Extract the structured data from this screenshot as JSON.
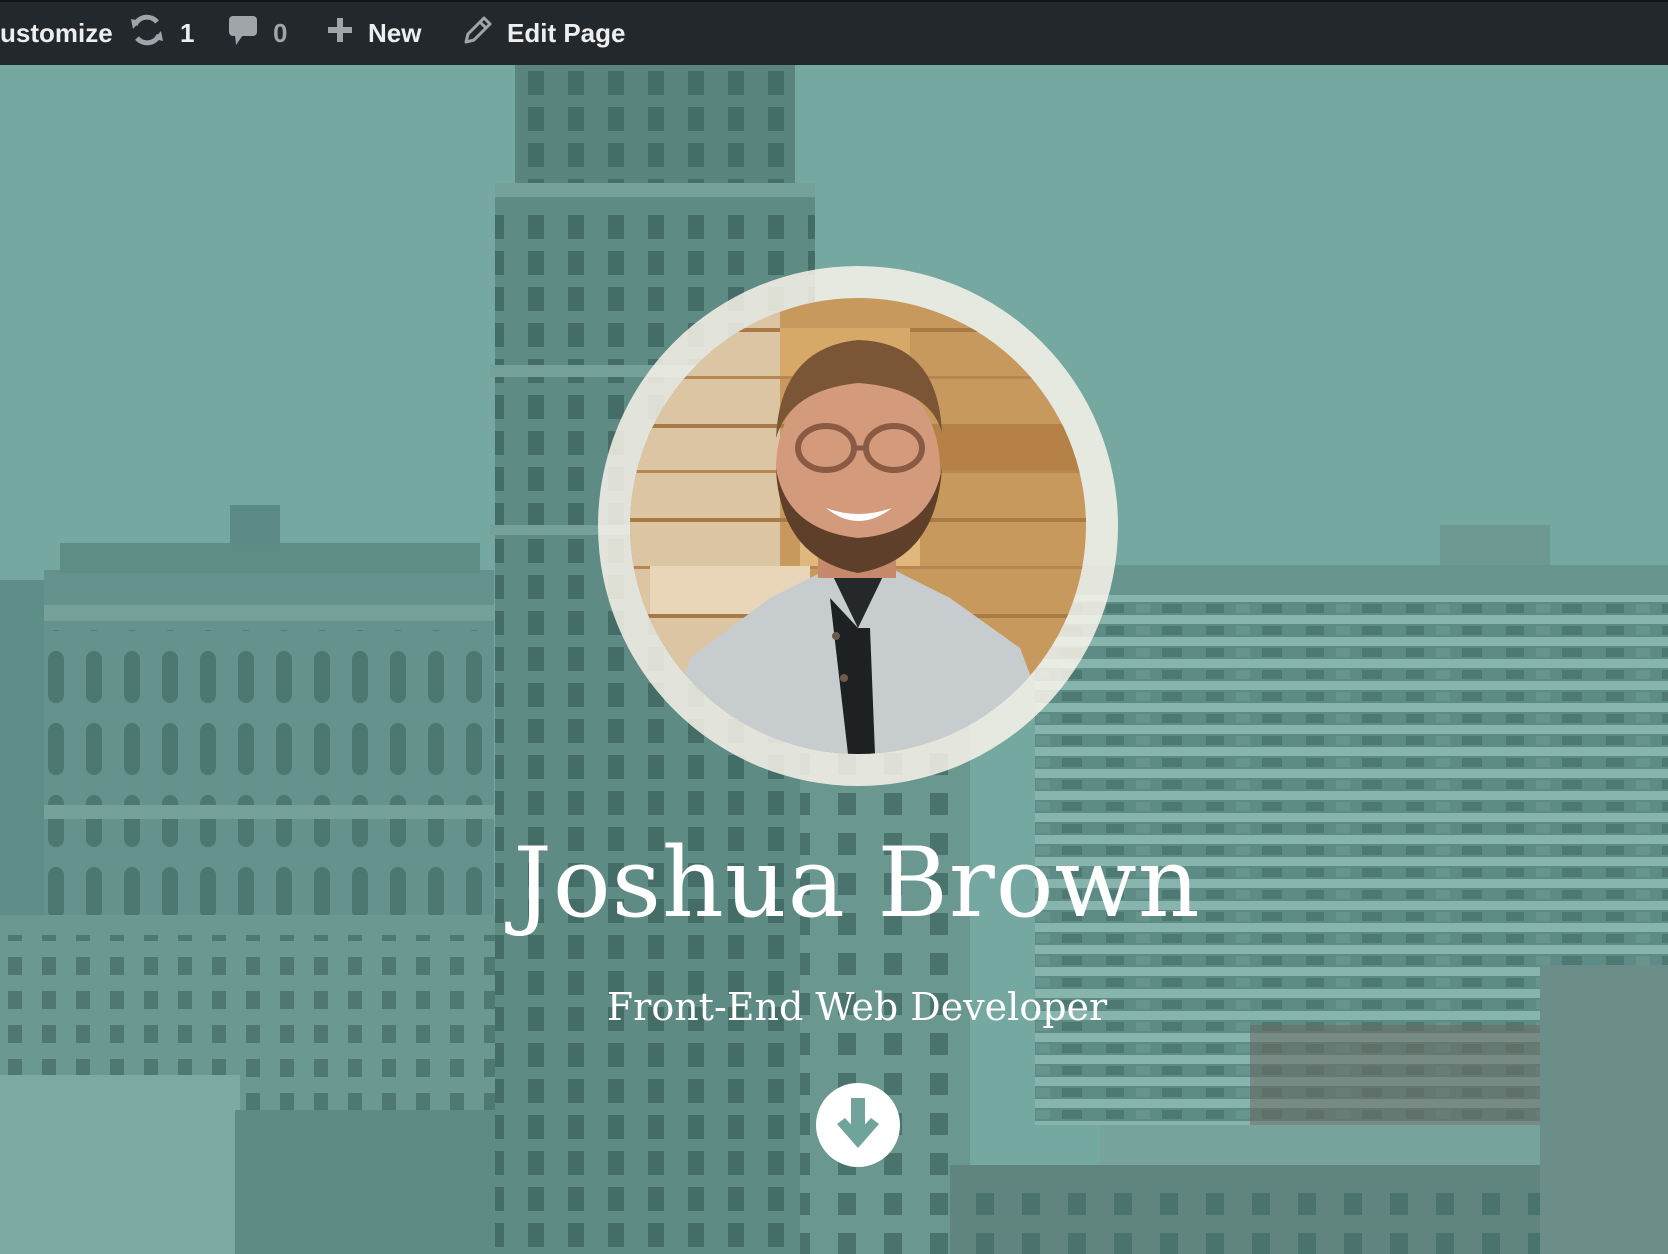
{
  "admin_bar": {
    "customize_label": "ustomize",
    "updates_count": "1",
    "comments_count": "0",
    "new_label": "New",
    "edit_label": "Edit Page",
    "background_color": "#23282d",
    "text_color": "#eeeeee",
    "icons": {
      "updates": "refresh-icon",
      "comments": "comment-bubble-icon",
      "new": "plus-icon",
      "edit": "pencil-icon"
    }
  },
  "hero": {
    "name": "Joshua Brown",
    "subtitle": "Front-End Web Developer",
    "overlay_color": "#73a7a1",
    "scroll_icon": "arrow-down-circle-icon",
    "avatar_icon": "profile-photo"
  }
}
